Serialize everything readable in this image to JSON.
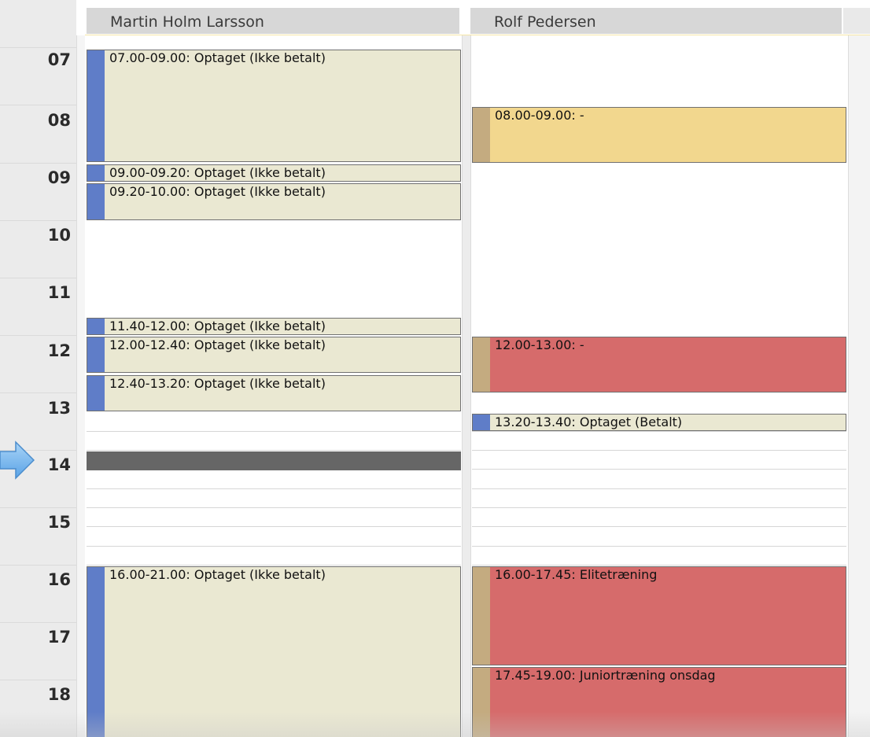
{
  "columns": [
    {
      "name": "Martin Holm Larsson"
    },
    {
      "name": "Rolf Pedersen"
    }
  ],
  "hours": [
    "07",
    "08",
    "09",
    "10",
    "11",
    "12",
    "13",
    "14",
    "15",
    "16",
    "17",
    "18"
  ],
  "current_hour": "14",
  "colors": {
    "unpaid_fill": "#eae8d2",
    "paid_fill": "#eae8d2",
    "booking_bar": "#5f7dc8",
    "training_fill": "#d66b6b",
    "reserved_fill": "#f2d78e",
    "training_bar": "#c4ab80",
    "busy_block": "#666666"
  },
  "events": {
    "martin": [
      {
        "text": "07.00-09.00: Optaget (Ikke betalt)"
      },
      {
        "text": "09.00-09.20: Optaget (Ikke betalt)"
      },
      {
        "text": "09.20-10.00: Optaget (Ikke betalt)"
      },
      {
        "text": "11.40-12.00: Optaget (Ikke betalt)"
      },
      {
        "text": "12.00-12.40: Optaget (Ikke betalt)"
      },
      {
        "text": "12.40-13.20: Optaget (Ikke betalt)"
      },
      {
        "text": "16.00-21.00: Optaget (Ikke betalt)"
      }
    ],
    "rolf": [
      {
        "text": "08.00-09.00: -"
      },
      {
        "text": "12.00-13.00: -"
      },
      {
        "text": "13.20-13.40: Optaget (Betalt)"
      },
      {
        "text": "16.00-17.45: Elitetræning"
      },
      {
        "text": "17.45-19.00: Juniortræning onsdag"
      }
    ]
  }
}
